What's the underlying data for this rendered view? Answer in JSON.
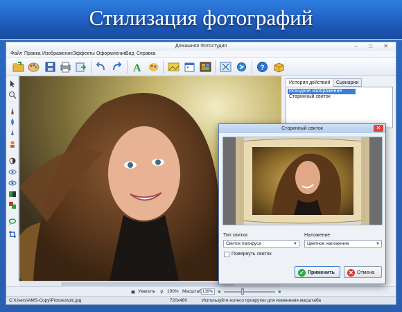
{
  "banner": {
    "title": "Стилизация фотографий"
  },
  "window": {
    "title": "Домашняя Фотостудия",
    "controls": "–  □  ✕"
  },
  "menu": [
    "Файл",
    "Правка",
    "Изображение",
    "Эффекты",
    "Оформление",
    "Вид",
    "Справка"
  ],
  "toolbar": {
    "icons": [
      "open-folder-icon",
      "palette-icon",
      "save-icon",
      "print-icon",
      "export-icon",
      "undo-icon",
      "redo-icon",
      "text-icon",
      "paint-icon",
      "image-icon",
      "calendar-icon",
      "collage-icon",
      "crop-icon",
      "rotate-icon",
      "help-icon",
      "box-icon"
    ]
  },
  "left_tools": [
    "pointer-icon",
    "zoom-icon",
    "brush-icon",
    "drop-icon",
    "pen-icon",
    "stamp-icon",
    "circle-icon",
    "eye-icon",
    "eye-icon",
    "layers-icon",
    "color-swap-icon",
    "lasso-icon",
    "crop-icon"
  ],
  "right_panel": {
    "tabs": [
      "История действий",
      "Сценарии"
    ],
    "history": [
      "Исходное изображение",
      "Старинный свиток"
    ],
    "selected_index": 0
  },
  "status": {
    "fit_label": "Умесить",
    "zoom_100": "100%",
    "scale_label": "Масштаб:",
    "scale_value": "139%",
    "path": "C:\\Users\\AMS-Copy\\Pictures\\pic.jpg",
    "dimensions": "720x480",
    "hint": "Используйте колесо прокрутки для изменения масштаба",
    "zoom_level": 0.35
  },
  "dialog": {
    "title": "Старинный свиток",
    "scroll_type_label": "Тип свитка",
    "scroll_type_value": "Свиток папируса",
    "overlay_label": "Наложение",
    "overlay_value": "Цветное наложение",
    "rotate_label": "Повернуть свиток",
    "rotate_checked": false,
    "apply_label": "Применить",
    "cancel_label": "Отмена"
  },
  "colors": {
    "banner_blue": "#1f5fc0",
    "selection": "#3c7fd6",
    "close_red": "#d9453b",
    "apply_green": "#28a745",
    "cancel_red": "#d63a2f"
  }
}
